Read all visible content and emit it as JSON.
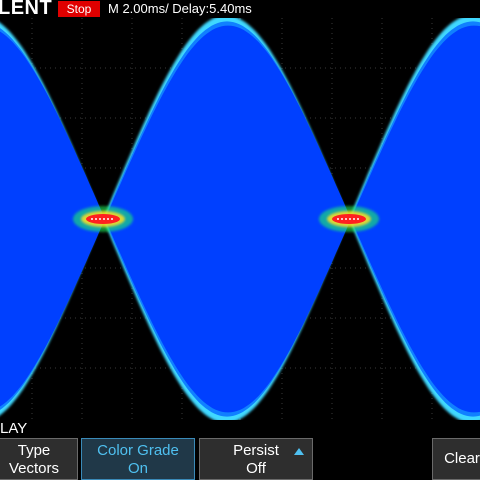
{
  "header": {
    "brand": "LENT",
    "run_state": "Stop",
    "timebase": "M 2.00ms/ Delay:5.40ms"
  },
  "colors": {
    "run_state_bg": "#e00000",
    "trace_outer": "#40d8ff",
    "trace_body": "#0040ff",
    "trace_hot": "#ff2020",
    "trigger_marker": "#3aa0ff",
    "active_key_text": "#4fc0f0"
  },
  "menu": {
    "title": "LAY",
    "softkeys": [
      {
        "title": "Type",
        "value": "Vectors",
        "active": false
      },
      {
        "title": "Color Grade",
        "value": "On",
        "active": true
      },
      {
        "title": "Persist",
        "value": "Off",
        "active": false,
        "icon": "arrow-up-icon"
      },
      {
        "title": "Clear",
        "value": "",
        "active": false
      }
    ]
  }
}
